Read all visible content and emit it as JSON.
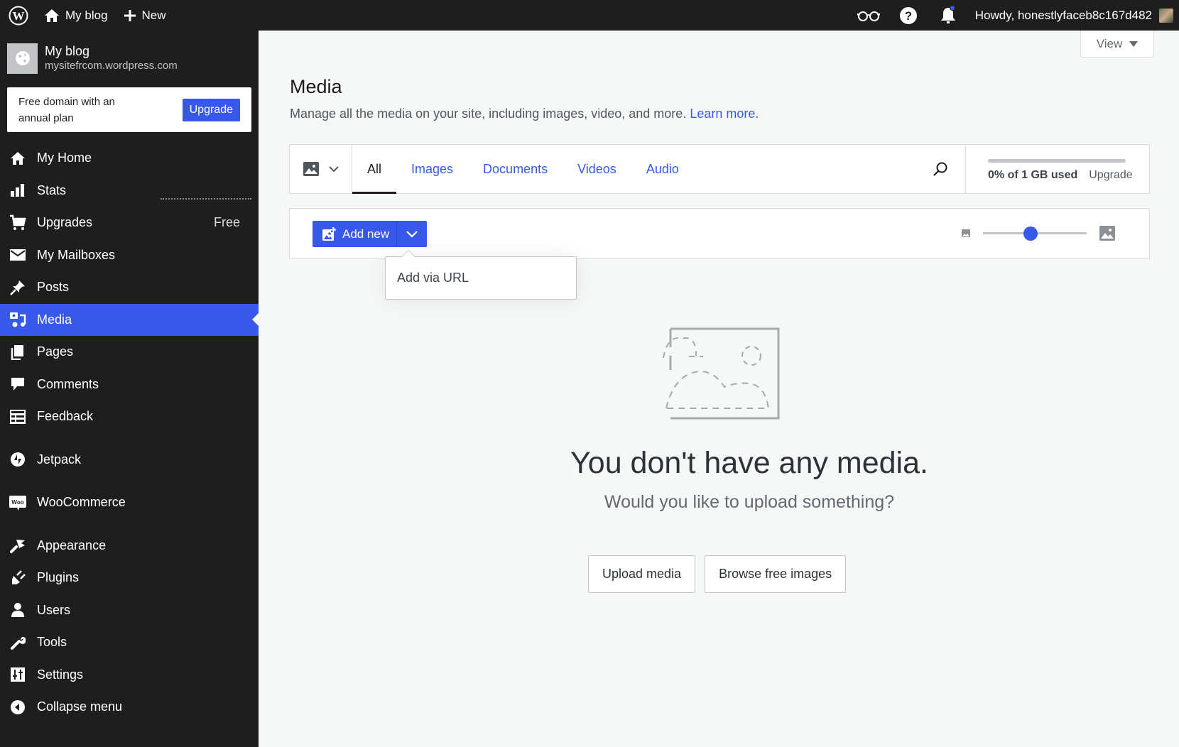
{
  "adminbar": {
    "site_label": "My blog",
    "new_label": "New",
    "howdy": "Howdy, honestlyfaceb8c167d482"
  },
  "sidebar": {
    "site_name": "My blog",
    "site_url": "mysitefrcom.wordpress.com",
    "upsell_text": "Free domain with an annual plan",
    "upsell_button": "Upgrade",
    "items": [
      {
        "label": "My Home",
        "icon": "home-icon"
      },
      {
        "label": "Stats",
        "icon": "stats-icon"
      },
      {
        "label": "Upgrades",
        "icon": "cart-icon",
        "badge": "Free"
      },
      {
        "label": "My Mailboxes",
        "icon": "mail-icon"
      },
      {
        "label": "Posts",
        "icon": "pin-icon"
      },
      {
        "label": "Media",
        "icon": "media-icon",
        "active": true
      },
      {
        "label": "Pages",
        "icon": "pages-icon"
      },
      {
        "label": "Comments",
        "icon": "comment-icon"
      },
      {
        "label": "Feedback",
        "icon": "feedback-icon"
      },
      {
        "label": "Jetpack",
        "icon": "jetpack-icon"
      },
      {
        "label": "WooCommerce",
        "icon": "woo-icon"
      },
      {
        "label": "Appearance",
        "icon": "brush-icon"
      },
      {
        "label": "Plugins",
        "icon": "plug-icon"
      },
      {
        "label": "Users",
        "icon": "user-icon"
      },
      {
        "label": "Tools",
        "icon": "wrench-icon"
      },
      {
        "label": "Settings",
        "icon": "settings-icon"
      },
      {
        "label": "Collapse menu",
        "icon": "collapse-icon"
      }
    ]
  },
  "main": {
    "view_label": "View",
    "title": "Media",
    "subtitle": "Manage all the media on your site, including images, video, and more.",
    "learn_more": "Learn more.",
    "tabs": [
      "All",
      "Images",
      "Documents",
      "Videos",
      "Audio"
    ],
    "selected_tab": "All",
    "storage": {
      "used_percent": 0,
      "used_label": "0% of 1 GB used",
      "upgrade_label": "Upgrade"
    },
    "add_new_label": "Add new",
    "dropdown_items": [
      "Add via URL"
    ],
    "thumbnail_size_fraction": 0.46,
    "empty": {
      "title": "You don't have any media.",
      "subtitle": "Would you like to upload something?",
      "upload_button": "Upload media",
      "browse_button": "Browse free images"
    }
  },
  "colors": {
    "accent": "#3858e9",
    "dark": "#1e1e1e",
    "background": "#f6f7f7"
  }
}
